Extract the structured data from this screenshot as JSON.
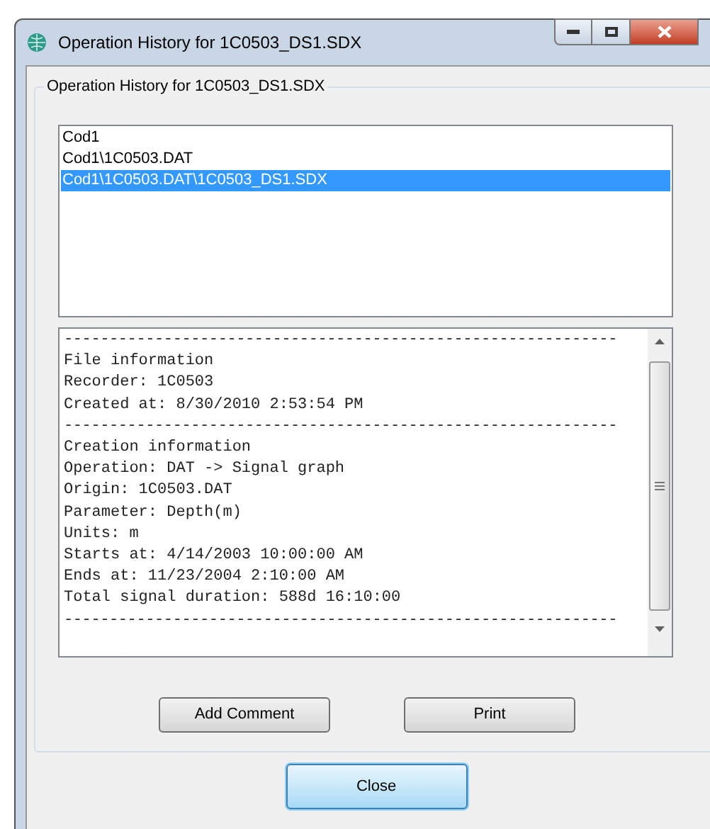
{
  "window": {
    "title": "Operation History for 1C0503_DS1.SDX"
  },
  "group": {
    "title": "Operation History for 1C0503_DS1.SDX"
  },
  "history_list": [
    {
      "label": "Cod1",
      "selected": false
    },
    {
      "label": "Cod1\\1C0503.DAT",
      "selected": false
    },
    {
      "label": "Cod1\\1C0503.DAT\\1C0503_DS1.SDX",
      "selected": true
    }
  ],
  "details": [
    {
      "kind": "rule",
      "text": "-------------------------------------------------------------"
    },
    {
      "kind": "line",
      "text": "File information"
    },
    {
      "kind": "line",
      "text": "Recorder: 1C0503"
    },
    {
      "kind": "line",
      "text": "Created at: 8/30/2010 2:53:54 PM"
    },
    {
      "kind": "rule",
      "text": "-------------------------------------------------------------"
    },
    {
      "kind": "line",
      "text": "Creation information"
    },
    {
      "kind": "line",
      "text": "Operation: DAT -> Signal graph"
    },
    {
      "kind": "line",
      "text": "Origin: 1C0503.DAT"
    },
    {
      "kind": "line",
      "text": "Parameter: Depth(m)"
    },
    {
      "kind": "line",
      "text": "Units: m"
    },
    {
      "kind": "line",
      "text": "Starts at: 4/14/2003 10:00:00 AM"
    },
    {
      "kind": "line",
      "text": "Ends at: 11/23/2004 2:10:00 AM"
    },
    {
      "kind": "line",
      "text": "Total signal duration: 588d 16:10:00"
    },
    {
      "kind": "rule",
      "text": "-------------------------------------------------------------"
    }
  ],
  "buttons": [
    {
      "label": "Add Comment"
    },
    {
      "label": "Print"
    }
  ],
  "close_button": {
    "label": "Close"
  }
}
